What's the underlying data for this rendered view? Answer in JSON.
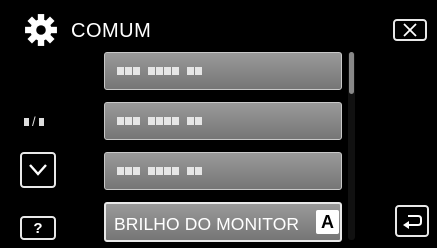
{
  "header": {
    "title": "COMUM",
    "icon": "gear-icon"
  },
  "nav": {
    "close_icon": "close-icon",
    "down_icon": "chevron-down-icon",
    "help_label": "?",
    "back_icon": "return-icon"
  },
  "menu": {
    "items": [
      {
        "label": ""
      },
      {
        "label": ""
      },
      {
        "label": ""
      },
      {
        "label": "BRILHO DO MONITOR",
        "badge": "A"
      }
    ]
  },
  "scroll": {
    "position": 0.0
  }
}
